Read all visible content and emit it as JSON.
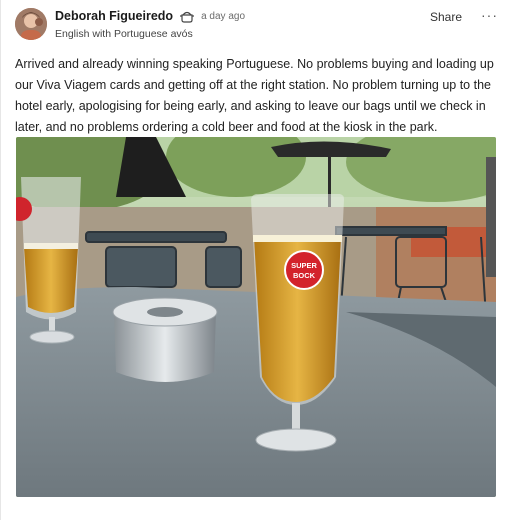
{
  "post": {
    "author": "Deborah Figueiredo",
    "time": "a day ago",
    "subtitle": "English with Portuguese avós",
    "share_label": "Share",
    "more_label": "···",
    "text": "Arrived and already winning speaking Portuguese. No problems buying and loading up our Viva Viagem cards and getting off at the right station. No problem turning up to the hotel early, apologising for being early, and asking to leave our bags until we check in later, and no problems ordering a cold beer and food at the kiosk in the park.",
    "photo": {
      "glass_label_line1": "SUPER",
      "glass_label_line2": "BOCK"
    }
  },
  "icons": {
    "badge": "cooking-pot-icon",
    "more": "more-horizontal-icon"
  }
}
